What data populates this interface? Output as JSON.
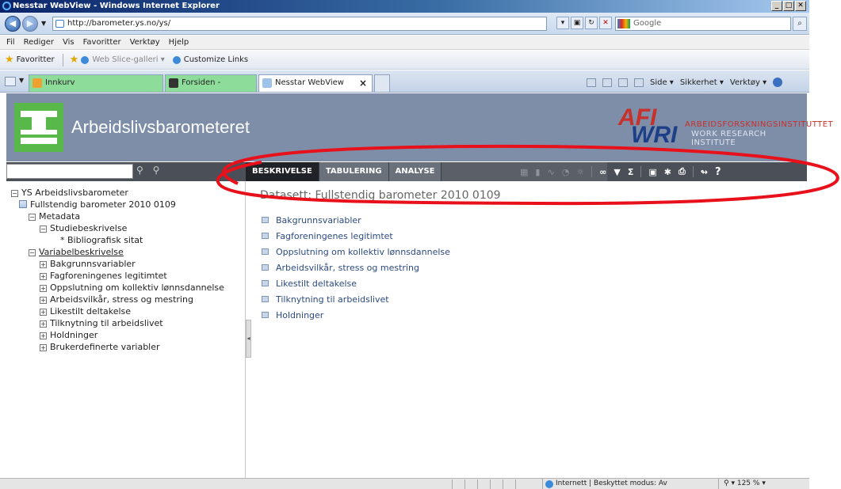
{
  "window": {
    "title": "Nesstar WebView - Windows Internet Explorer",
    "min": "_",
    "max": "□",
    "close": "✕"
  },
  "addressbar": {
    "url": "http://barometer.ys.no/ys/",
    "search_placeholder": "Google",
    "go": "⌕"
  },
  "menubar": {
    "items": [
      "Fil",
      "Rediger",
      "Vis",
      "Favoritter",
      "Verktøy",
      "Hjelp"
    ]
  },
  "favbar": {
    "favorites_label": "Favoritter",
    "web_slice": "Web Slice-galleri ▾",
    "customize": "Customize Links"
  },
  "tabs": {
    "items": [
      {
        "label": "Innkurv"
      },
      {
        "label": "Forsiden - Aftenposten.no"
      },
      {
        "label": "Nesstar WebView"
      }
    ],
    "commands": [
      "Side ▾",
      "Sikkerhet ▾",
      "Verktøy ▾"
    ]
  },
  "header": {
    "title": "Arbeidslivsbarometeret",
    "afi_big": "AFI",
    "wri_big": "WRI",
    "afi_line1": "ARBEIDSFORSKNINGSINSTITUTTET",
    "afi_line2": "WORK RESEARCH INSTITUTE"
  },
  "viewtabs": {
    "description": "BESKRIVELSE",
    "tabulation": "TABULERING",
    "analysis": "ANALYSE"
  },
  "tree": {
    "root": "YS Arbeidslivsbarometer",
    "dataset": "Fullstendig barometer 2010 0109",
    "metadata": "Metadata",
    "study": "Studiebeskrivelse",
    "citation": "* Bibliografisk sitat",
    "variables": "Variabelbeskrivelse",
    "groups": [
      "Bakgrunnsvariabler",
      "Fagforeningenes legitimtet",
      "Oppslutning om kollektiv lønnsdannelse",
      "Arbeidsvilkår, stress og mestring",
      "Likestilt deltakelse",
      "Tilknytning til arbeidslivet",
      "Holdninger",
      "Brukerdefinerte variabler"
    ]
  },
  "main": {
    "dataset_title": "Datasett: Fullstendig barometer 2010 0109",
    "groups": [
      "Bakgrunnsvariabler",
      "Fagforeningenes legitimtet",
      "Oppslutning om kollektiv lønnsdannelse",
      "Arbeidsvilkår, stress og mestring",
      "Likestilt deltakelse",
      "Tilknytning til arbeidslivet",
      "Holdninger"
    ]
  },
  "statusbar": {
    "zone": "Internett | Beskyttet modus: Av",
    "zoom": "125 %"
  },
  "colors": {
    "title_gradient_start": "#0a246a",
    "header_bg": "#7e8ea8",
    "strip_bg": "#4a4f58",
    "logo_green": "#58b84a",
    "afi_red": "#c7302b",
    "wri_blue": "#1d3f88",
    "annotation_red": "#e8101a",
    "link_blue": "#2b4a80"
  }
}
